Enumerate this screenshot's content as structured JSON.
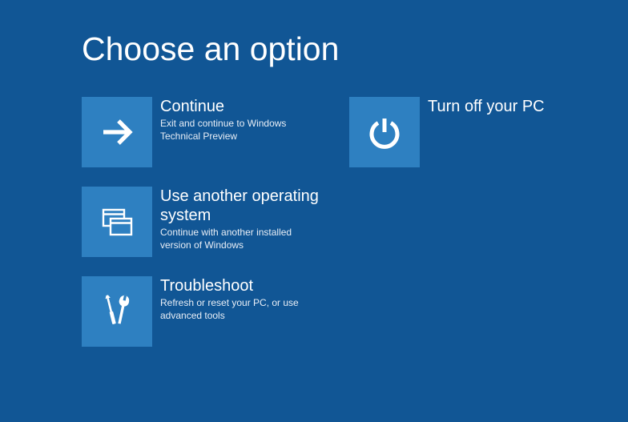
{
  "title": "Choose an option",
  "options": {
    "continue": {
      "title": "Continue",
      "desc": "Exit and continue to Windows Technical Preview"
    },
    "use_another": {
      "title": "Use another operating system",
      "desc": "Continue with another installed version of Windows"
    },
    "troubleshoot": {
      "title": "Troubleshoot",
      "desc": "Refresh or reset your PC, or use advanced tools"
    },
    "turn_off": {
      "title": "Turn off your PC",
      "desc": ""
    }
  }
}
